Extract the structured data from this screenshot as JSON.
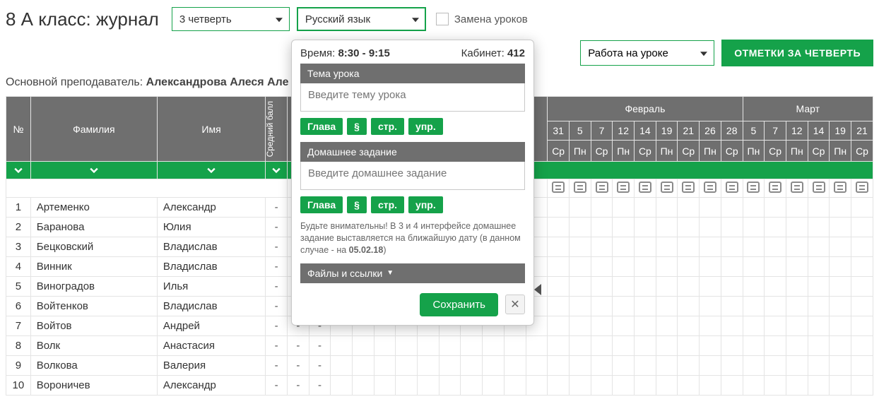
{
  "header": {
    "title": "8 А класс: журнал",
    "quarter": "3 четверть",
    "subject": "Русский язык",
    "sub_label": "Замена уроков",
    "work_type": "Работа на уроке",
    "marks_btn": "ОТМЕТКИ ЗА ЧЕТВЕРТЬ"
  },
  "teacher": {
    "prefix": "Основной преподаватель: ",
    "name": "Александрова Алеся Але"
  },
  "cols": {
    "num": "№",
    "surname": "Фамилия",
    "name": "Имя",
    "avg": "Средний балл"
  },
  "months": [
    "Февраль",
    "Март"
  ],
  "days_feb": [
    "31",
    "5",
    "7",
    "12",
    "14",
    "19",
    "21",
    "26",
    "28"
  ],
  "dow_feb": [
    "Ср",
    "Пн",
    "Ср",
    "Пн",
    "Ср",
    "Пн",
    "Ср",
    "Пн",
    "Ср"
  ],
  "days_mar": [
    "5",
    "7",
    "12",
    "14",
    "19",
    "21"
  ],
  "dow_mar": [
    "Пн",
    "Ср",
    "Пн",
    "Ср",
    "Пн",
    "Ср"
  ],
  "hidden_slots": 12,
  "students": [
    {
      "n": "1",
      "s": "Артеменко",
      "f": "Александр",
      "a": "-"
    },
    {
      "n": "2",
      "s": "Баранова",
      "f": "Юлия",
      "a": "-"
    },
    {
      "n": "3",
      "s": "Бецковский",
      "f": "Владислав",
      "a": "-"
    },
    {
      "n": "4",
      "s": "Винник",
      "f": "Владислав",
      "a": "-"
    },
    {
      "n": "5",
      "s": "Виноградов",
      "f": "Илья",
      "a": "-"
    },
    {
      "n": "6",
      "s": "Войтенков",
      "f": "Владислав",
      "a": "-"
    },
    {
      "n": "7",
      "s": "Войтов",
      "f": "Андрей",
      "a": "-"
    },
    {
      "n": "8",
      "s": "Волк",
      "f": "Анастасия",
      "a": "-"
    },
    {
      "n": "9",
      "s": "Волкова",
      "f": "Валерия",
      "a": "-"
    },
    {
      "n": "10",
      "s": "Вороничев",
      "f": "Александр",
      "a": "-"
    }
  ],
  "modal": {
    "time_label": "Время: ",
    "time": "8:30 - 9:15",
    "room_label": "Кабинет: ",
    "room": "412",
    "topic_label": "Тема урока",
    "topic_ph": "Введите тему урока",
    "hw_label": "Домашнее задание",
    "hw_ph": "Введите домашнее задание",
    "chips": [
      "Глава",
      "§",
      "стр.",
      "упр."
    ],
    "hint_a": "Будьте внимательны! В 3 и 4 интерфейсе домашнее задание выставляется на ближайшую дату (в данном случае - на ",
    "hint_date": "05.02.18",
    "hint_b": ")",
    "files": "Файлы и ссылки",
    "save": "Сохранить"
  }
}
